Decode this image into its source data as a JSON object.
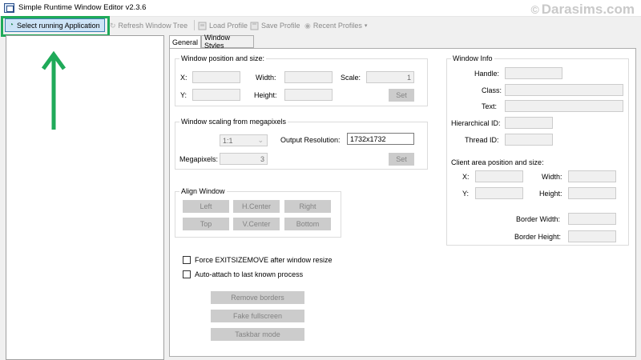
{
  "window": {
    "title": "Simple Runtime Window Editor v2.3.6",
    "watermark": "Darasims.com"
  },
  "toolbar": {
    "select_app": "Select running Application",
    "refresh_tree": "Refresh Window Tree",
    "load_profile": "Load Profile",
    "save_profile": "Save Profile",
    "recent_profiles": "Recent Profiles"
  },
  "tabs": {
    "general": "General",
    "window_styles": "Window Styles"
  },
  "position": {
    "title": "Window position and size:",
    "x_label": "X:",
    "y_label": "Y:",
    "width_label": "Width:",
    "height_label": "Height:",
    "scale_label": "Scale:",
    "scale_value": "1",
    "set_label": "Set"
  },
  "scaling": {
    "title": "Window scaling from megapixels",
    "ratio_value": "1:1",
    "output_label": "Output Resolution:",
    "output_value": "1732x1732",
    "megapixels_label": "Megapixels:",
    "megapixels_value": "3",
    "set_label": "Set"
  },
  "align": {
    "title": "Align Window",
    "left": "Left",
    "hcenter": "H.Center",
    "right": "Right",
    "top": "Top",
    "vcenter": "V.Center",
    "bottom": "Bottom"
  },
  "options": {
    "force_exitsizemove": "Force EXITSIZEMOVE after window resize",
    "auto_attach": "Auto-attach to last known process"
  },
  "actions": {
    "remove_borders": "Remove borders",
    "fake_fullscreen": "Fake fullscreen",
    "taskbar_mode": "Taskbar mode"
  },
  "info": {
    "title": "Window Info",
    "handle": "Handle:",
    "class": "Class:",
    "text": "Text:",
    "hierarchical_id": "Hierarchical ID:",
    "thread_id": "Thread ID:",
    "client_title": "Client area position and size:",
    "x": "X:",
    "y": "Y:",
    "width": "Width:",
    "height": "Height:",
    "border_width": "Border Width:",
    "border_height": "Border Height:"
  },
  "colors": {
    "highlight": "#1faa59",
    "select_button": "#cde4f7"
  },
  "icons": [
    "app-icon",
    "refresh-icon",
    "load-icon",
    "save-icon",
    "recent-icon",
    "chevron-down-icon",
    "up-arrow-icon",
    "copyright-icon"
  ]
}
